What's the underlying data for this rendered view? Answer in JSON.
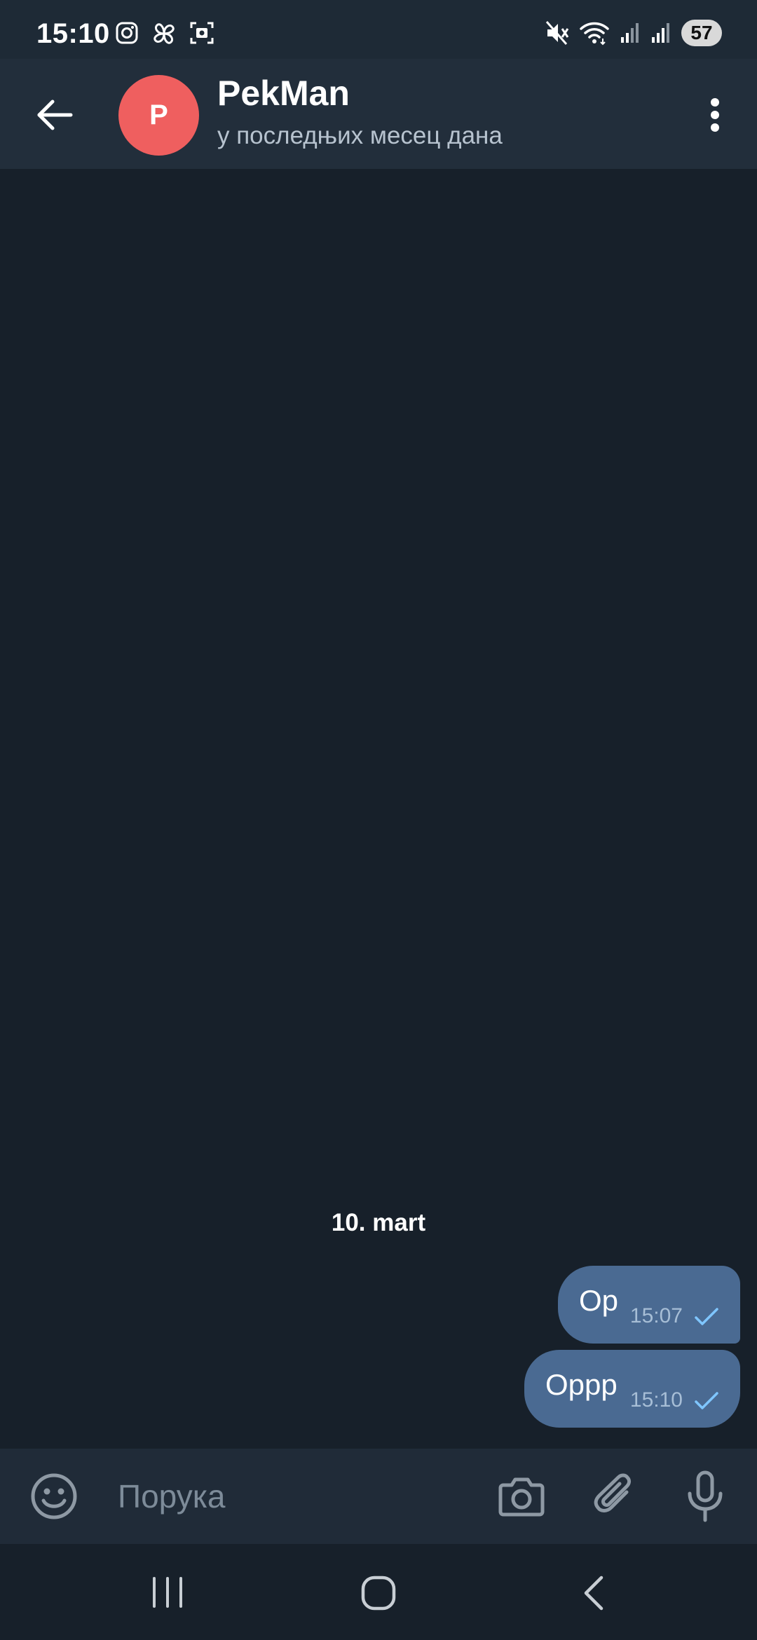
{
  "status_bar": {
    "time": "15:10",
    "battery": "57",
    "left_icons": [
      "instagram-icon",
      "pinwheel-icon",
      "screenshot-icon"
    ],
    "right_icons": [
      "mute-icon",
      "wifi-icon",
      "signal-icon",
      "signal-icon"
    ]
  },
  "header": {
    "back_icon": "arrow-left-icon",
    "avatar_letter": "P",
    "avatar_color": "#ef5f5f",
    "contact_name": "PekMan",
    "contact_status": "у последњих месец дана",
    "menu_icon": "more-vertical-icon"
  },
  "chat": {
    "date_label": "10. mart",
    "messages": [
      {
        "text": "Op",
        "time": "15:07",
        "status": "sent",
        "check_icon": "check-icon"
      },
      {
        "text": "Oppp",
        "time": "15:10",
        "status": "sent",
        "check_icon": "check-icon"
      }
    ],
    "bubble_color": "#4a6a92",
    "background_color": "#17202a"
  },
  "input_bar": {
    "placeholder": "Порука",
    "value": "",
    "emoji_icon": "smiley-icon",
    "camera_icon": "camera-icon",
    "attach_icon": "paperclip-icon",
    "mic_icon": "microphone-icon"
  },
  "nav_bar": {
    "recents_icon": "recents-icon",
    "home_icon": "home-icon",
    "back_icon": "nav-back-icon"
  }
}
